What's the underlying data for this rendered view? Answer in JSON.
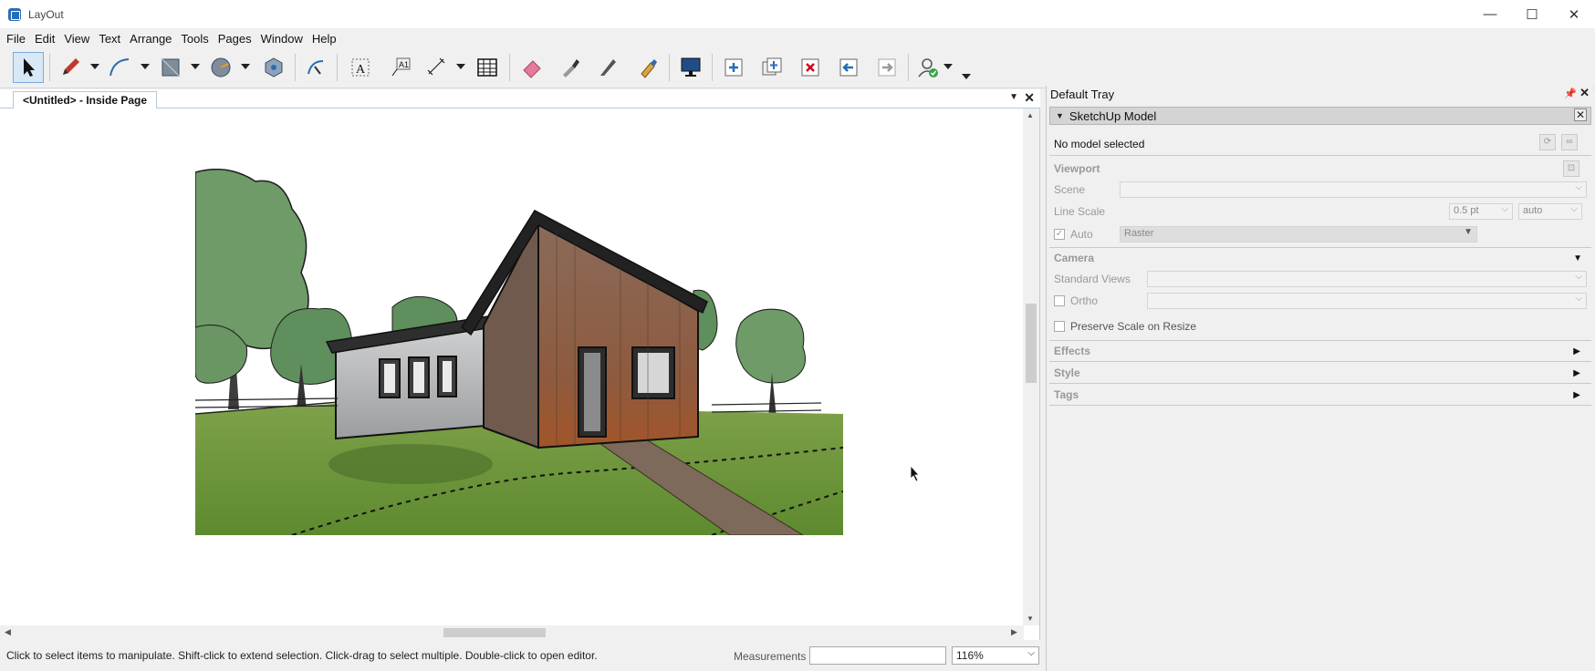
{
  "app": {
    "title": "LayOut",
    "min": "—",
    "max": "☐",
    "close": "✕"
  },
  "menu": [
    "File",
    "Edit",
    "View",
    "Text",
    "Arrange",
    "Tools",
    "Pages",
    "Window",
    "Help"
  ],
  "tabs": [
    {
      "label": "<Untitled> - Inside Page"
    }
  ],
  "status": {
    "hint": "Click to select items to manipulate. Shift-click to extend selection. Click-drag to select multiple. Double-click to open editor.",
    "measurements_label": "Measurements",
    "measurements_value": "",
    "zoom": "116%"
  },
  "tray": {
    "title": "Default Tray",
    "panel": "SketchUp Model",
    "model_status": "No model selected",
    "viewport": {
      "heading": "Viewport",
      "scene_label": "Scene",
      "scene_value": "",
      "line_scale_label": "Line Scale",
      "line_scale_value": "0.5 pt",
      "line_scale_mode": "auto",
      "auto_label": "Auto",
      "render_mode": "Raster"
    },
    "camera": {
      "heading": "Camera",
      "standard_views_label": "Standard Views",
      "standard_views_value": "",
      "ortho_label": "Ortho",
      "ortho_value": ""
    },
    "preserve_label": "Preserve Scale on Resize",
    "sections": [
      "Effects",
      "Style",
      "Tags"
    ]
  },
  "colors": {
    "accent": "#2a6db5",
    "selection": "#d9e8f7"
  }
}
